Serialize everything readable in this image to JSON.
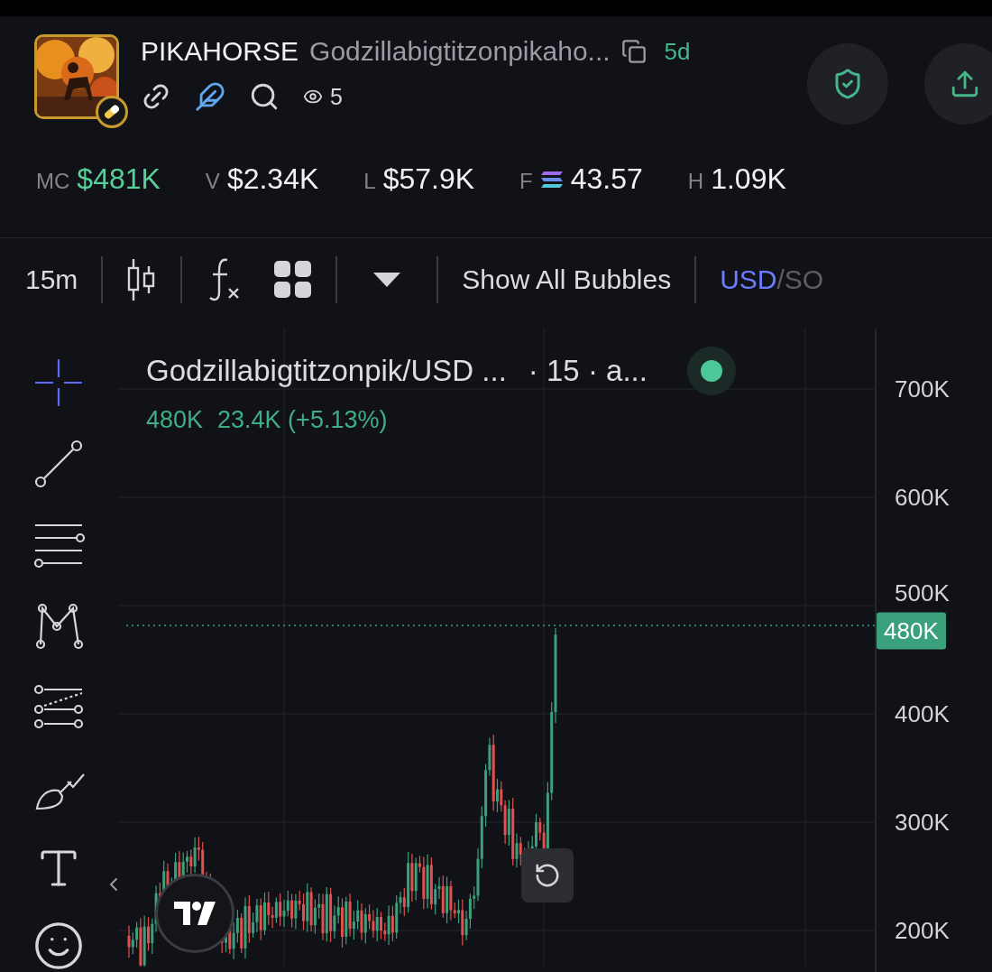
{
  "token": {
    "symbol": "PIKAHORSE",
    "name": "Godzillabigtitzonpikaho...",
    "age": "5d",
    "watchers": "5"
  },
  "stats": [
    {
      "label": "MC",
      "value": "$481K",
      "kind": "gain"
    },
    {
      "label": "V",
      "value": "$2.34K",
      "kind": "plain"
    },
    {
      "label": "L",
      "value": "$57.9K",
      "kind": "plain"
    },
    {
      "label": "F",
      "value": "43.57",
      "kind": "token"
    },
    {
      "label": "H",
      "value": "1.09K",
      "kind": "plain"
    }
  ],
  "toolbar": {
    "interval": "15m",
    "bubbles_button": "Show All Bubbles",
    "currency_separator": "/",
    "currency": [
      {
        "label": "USD",
        "selected": true
      },
      {
        "label": "SO",
        "selected": false
      }
    ]
  },
  "drawing_tools": [
    {
      "kind": "crosshair",
      "selected": true
    },
    {
      "kind": "trend-line",
      "selected": false
    },
    {
      "kind": "lines",
      "selected": false
    },
    {
      "kind": "pattern",
      "selected": false
    },
    {
      "kind": "channel",
      "selected": false
    },
    {
      "kind": "brush",
      "selected": false
    },
    {
      "kind": "text",
      "selected": false
    },
    {
      "kind": "emoji",
      "selected": false
    }
  ],
  "chart": {
    "legend": {
      "pair": "Godzillabigtitzonpik/USD ...",
      "details": "· 15 · a...",
      "price": "480K",
      "change": "23.4K (+5.13%)"
    },
    "price_axis": [
      "700K",
      "600K",
      "500K",
      "400K",
      "300K",
      "200K"
    ],
    "current_price": "480K"
  }
}
